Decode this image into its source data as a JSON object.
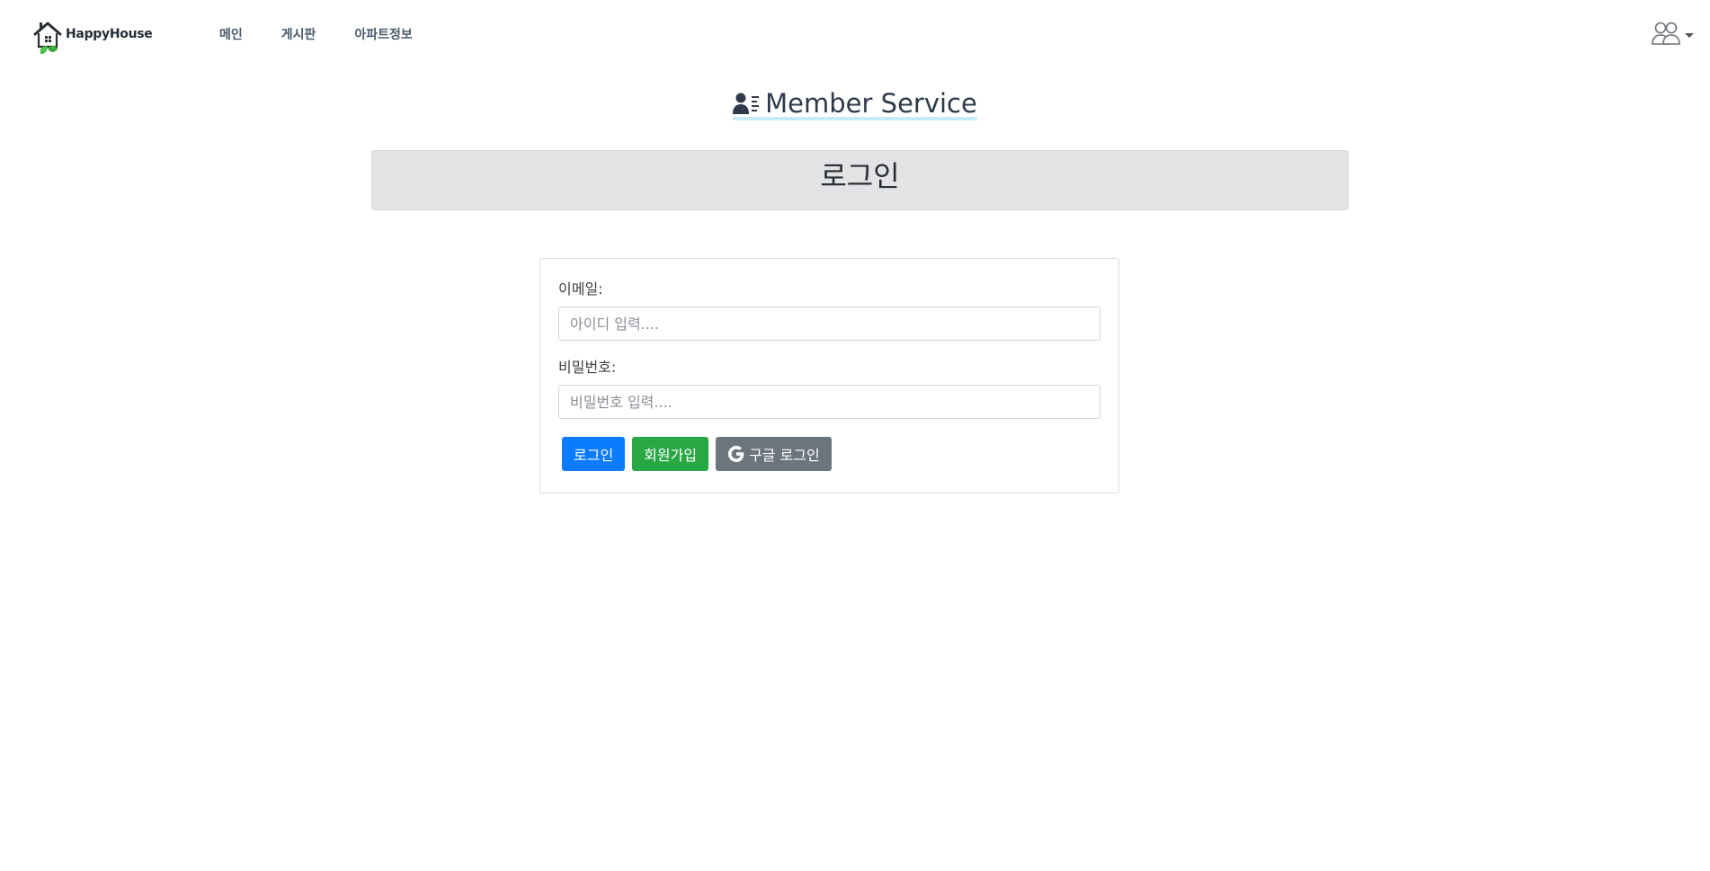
{
  "brand": {
    "name": "HappyHouse",
    "logo_icon": "house-leaf-logo"
  },
  "nav": {
    "items": [
      {
        "label": "메인"
      },
      {
        "label": "게시판"
      },
      {
        "label": "아파트정보"
      }
    ]
  },
  "user_menu": {
    "icon": "users-icon"
  },
  "heading": {
    "icon": "user-card-icon",
    "text": "Member Service"
  },
  "banner": {
    "title": "로그인"
  },
  "form": {
    "email_label": "이메일:",
    "email_placeholder": "아이디 입력....",
    "email_value": "",
    "password_label": "비밀번호:",
    "password_placeholder": "비밀번호 입력....",
    "password_value": ""
  },
  "buttons": {
    "login_label": "로그인",
    "signup_label": "회원가입",
    "google_label": "구글 로그인",
    "google_icon": "google-icon"
  },
  "colors": {
    "primary": "#0b7bff",
    "success": "#28a745",
    "secondary": "#6c757d",
    "banner_bg": "#e2e3e5",
    "heading_underline": "#c8ecf7"
  }
}
